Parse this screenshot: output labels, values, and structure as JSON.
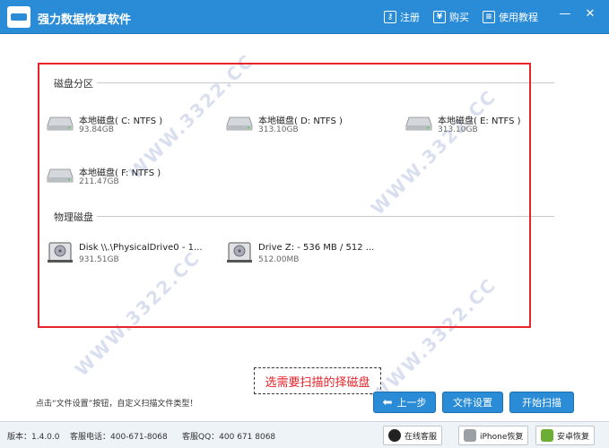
{
  "app": {
    "title": "强力数据恢复软件",
    "toolbar": {
      "register": "注册",
      "buy": "购买",
      "tutorial": "使用教程"
    },
    "window_controls": {
      "minimize": "—",
      "close": "✕"
    }
  },
  "partitions": {
    "label": "磁盘分区",
    "drives": [
      {
        "name": "本地磁盘( C: NTFS )",
        "size": "93.84GB"
      },
      {
        "name": "本地磁盘( D: NTFS )",
        "size": "313.10GB"
      },
      {
        "name": "本地磁盘( E: NTFS )",
        "size": "313.10GB"
      },
      {
        "name": "本地磁盘( F: NTFS )",
        "size": "211.47GB"
      }
    ]
  },
  "physical": {
    "label": "物理磁盘",
    "drives": [
      {
        "name": "Disk \\\\.\\PhysicalDrive0 - 1...",
        "size": "931.51GB"
      },
      {
        "name": "Drive Z: - 536 MB / 512 ...",
        "size": "512.00MB"
      }
    ]
  },
  "hint": "选需要扫描的择磁盘",
  "tip": "点击“文件设置”按钮，自定义扫描文件类型！",
  "buttons": {
    "back": "上一步",
    "file_settings": "文件设置",
    "start_scan": "开始扫描"
  },
  "status": {
    "version": "版本：1.4.0.0",
    "phone": "客服电话：400-671-8068",
    "qq": "客服QQ：400 671 8068",
    "online": "在线客服",
    "iphone": "iPhone恢复",
    "android": "安卓恢复"
  },
  "watermark": "WWW.3322.CC",
  "colors": {
    "titlebar": "#2a8bd6",
    "highlight": "#e8232a",
    "button": "#2a8bd6"
  }
}
